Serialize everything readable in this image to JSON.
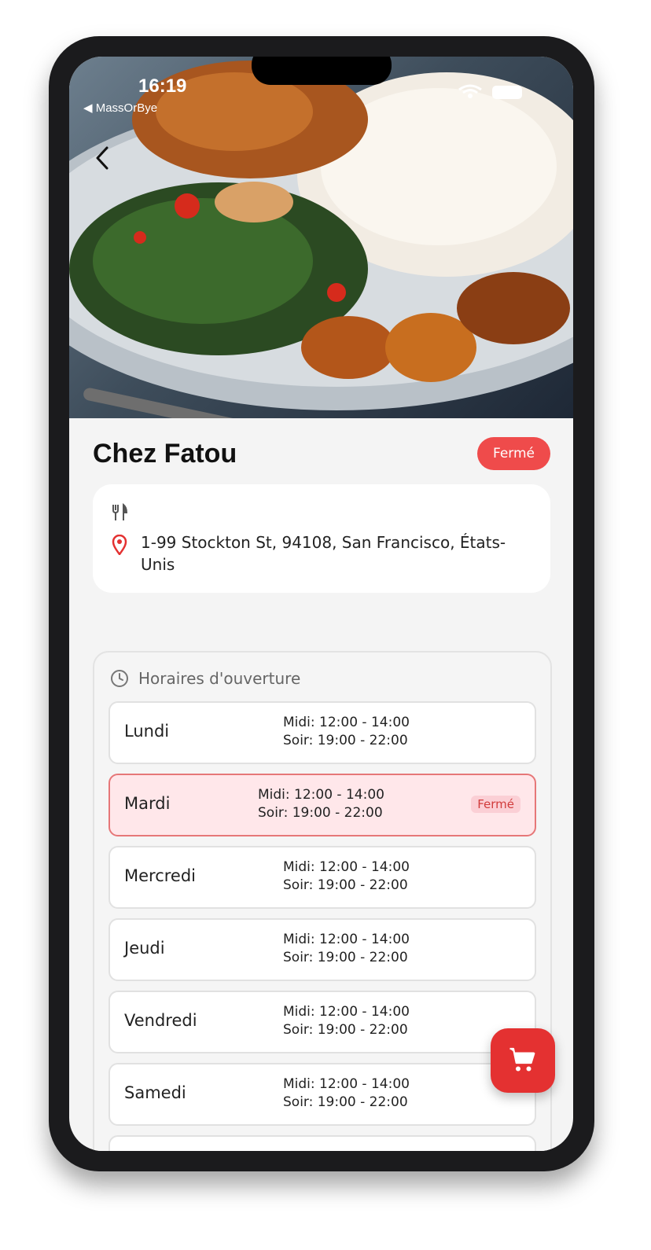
{
  "status_bar": {
    "time": "16:19",
    "back_app": "◀ MassOrBye"
  },
  "restaurant": {
    "name": "Chez Fatou",
    "status_badge": "Fermé",
    "address": "1-99 Stockton St, 94108, San Francisco, États-Unis"
  },
  "hours": {
    "title": "Horaires d'ouverture",
    "days": [
      {
        "day": "Lundi",
        "midi": "Midi: 12:00 - 14:00",
        "soir": "Soir: 19:00 - 22:00",
        "badge": ""
      },
      {
        "day": "Mardi",
        "midi": "Midi: 12:00 - 14:00",
        "soir": "Soir: 19:00 - 22:00",
        "badge": "Fermé"
      },
      {
        "day": "Mercredi",
        "midi": "Midi: 12:00 - 14:00",
        "soir": "Soir: 19:00 - 22:00",
        "badge": ""
      },
      {
        "day": "Jeudi",
        "midi": "Midi: 12:00 - 14:00",
        "soir": "Soir: 19:00 - 22:00",
        "badge": ""
      },
      {
        "day": "Vendredi",
        "midi": "Midi: 12:00 - 14:00",
        "soir": "Soir: 19:00 - 22:00",
        "badge": ""
      },
      {
        "day": "Samedi",
        "midi": "Midi: 12:00 - 14:00",
        "soir": "Soir: 19:00 - 22:00",
        "badge": ""
      }
    ]
  },
  "icons": {
    "back": "chevron-left-icon",
    "cuisine": "utensils-icon",
    "location": "map-pin-icon",
    "clock": "clock-icon",
    "cart": "cart-icon",
    "wifi": "wifi-icon",
    "battery": "battery-icon"
  },
  "colors": {
    "accent_red": "#e43131",
    "closed_badge": "#ef4b4b",
    "closed_row_bg": "#ffe7ea",
    "closed_row_border": "#e67778"
  }
}
